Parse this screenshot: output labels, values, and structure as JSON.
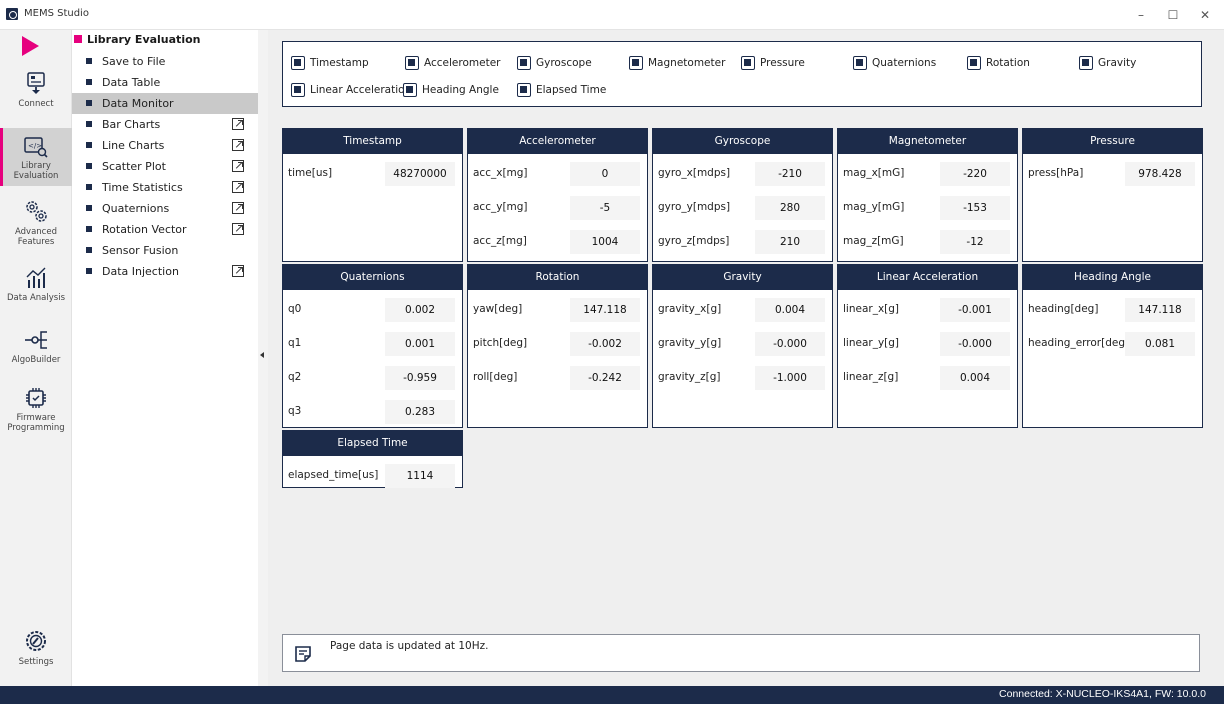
{
  "window": {
    "title": "MEMS Studio",
    "minimize": "–",
    "maximize": "☐",
    "close": "✕"
  },
  "rail": {
    "items": [
      {
        "label": "Connect",
        "icon": "connect-icon"
      },
      {
        "label": "Library Evaluation",
        "icon": "library-evaluation-icon"
      },
      {
        "label": "Advanced Features",
        "icon": "advanced-features-icon"
      },
      {
        "label": "Data Analysis",
        "icon": "data-analysis-icon"
      },
      {
        "label": "AlgoBuilder",
        "icon": "algobuilder-icon"
      },
      {
        "label": "Firmware Programming",
        "icon": "firmware-programming-icon"
      },
      {
        "label": "Settings",
        "icon": "settings-icon"
      }
    ],
    "active": "Library Evaluation"
  },
  "menu": {
    "header": "Library Evaluation",
    "items": [
      {
        "label": "Save to File",
        "external": false
      },
      {
        "label": "Data Table",
        "external": false
      },
      {
        "label": "Data Monitor",
        "external": false,
        "selected": true
      },
      {
        "label": "Bar Charts",
        "external": true
      },
      {
        "label": "Line Charts",
        "external": true
      },
      {
        "label": "Scatter Plot",
        "external": true
      },
      {
        "label": "Time Statistics",
        "external": true
      },
      {
        "label": "Quaternions",
        "external": true
      },
      {
        "label": "Rotation Vector",
        "external": true
      },
      {
        "label": "Sensor Fusion",
        "external": false
      },
      {
        "label": "Data Injection",
        "external": true
      }
    ]
  },
  "checkboxes": [
    {
      "label": "Timestamp",
      "checked": true
    },
    {
      "label": "Accelerometer",
      "checked": true
    },
    {
      "label": "Gyroscope",
      "checked": true
    },
    {
      "label": "Magnetometer",
      "checked": true
    },
    {
      "label": "Pressure",
      "checked": true
    },
    {
      "label": "Quaternions",
      "checked": true
    },
    {
      "label": "Rotation",
      "checked": true
    },
    {
      "label": "Gravity",
      "checked": true
    },
    {
      "label": "Linear Acceleration",
      "checked": true
    },
    {
      "label": "Heading Angle",
      "checked": true
    },
    {
      "label": "Elapsed Time",
      "checked": true
    }
  ],
  "cards": {
    "timestamp": {
      "title": "Timestamp",
      "rows": [
        {
          "label": "time[us]",
          "value": "48270000"
        }
      ]
    },
    "accelerometer": {
      "title": "Accelerometer",
      "rows": [
        {
          "label": "acc_x[mg]",
          "value": "0"
        },
        {
          "label": "acc_y[mg]",
          "value": "-5"
        },
        {
          "label": "acc_z[mg]",
          "value": "1004"
        }
      ]
    },
    "gyroscope": {
      "title": "Gyroscope",
      "rows": [
        {
          "label": "gyro_x[mdps]",
          "value": "-210"
        },
        {
          "label": "gyro_y[mdps]",
          "value": "280"
        },
        {
          "label": "gyro_z[mdps]",
          "value": "210"
        }
      ]
    },
    "magnetometer": {
      "title": "Magnetometer",
      "rows": [
        {
          "label": "mag_x[mG]",
          "value": "-220"
        },
        {
          "label": "mag_y[mG]",
          "value": "-153"
        },
        {
          "label": "mag_z[mG]",
          "value": "-12"
        }
      ]
    },
    "pressure": {
      "title": "Pressure",
      "rows": [
        {
          "label": "press[hPa]",
          "value": "978.428"
        }
      ]
    },
    "quaternions": {
      "title": "Quaternions",
      "rows": [
        {
          "label": "q0",
          "value": "0.002"
        },
        {
          "label": "q1",
          "value": "0.001"
        },
        {
          "label": "q2",
          "value": "-0.959"
        },
        {
          "label": "q3",
          "value": "0.283"
        }
      ]
    },
    "rotation": {
      "title": "Rotation",
      "rows": [
        {
          "label": "yaw[deg]",
          "value": "147.118"
        },
        {
          "label": "pitch[deg]",
          "value": "-0.002"
        },
        {
          "label": "roll[deg]",
          "value": "-0.242"
        }
      ]
    },
    "gravity": {
      "title": "Gravity",
      "rows": [
        {
          "label": "gravity_x[g]",
          "value": "0.004"
        },
        {
          "label": "gravity_y[g]",
          "value": "-0.000"
        },
        {
          "label": "gravity_z[g]",
          "value": "-1.000"
        }
      ]
    },
    "linear_acceleration": {
      "title": "Linear Acceleration",
      "rows": [
        {
          "label": "linear_x[g]",
          "value": "-0.001"
        },
        {
          "label": "linear_y[g]",
          "value": "-0.000"
        },
        {
          "label": "linear_z[g]",
          "value": "0.004"
        }
      ]
    },
    "heading_angle": {
      "title": "Heading Angle",
      "rows": [
        {
          "label": "heading[deg]",
          "value": "147.118"
        },
        {
          "label": "heading_error[deg]",
          "value": "0.081"
        }
      ]
    },
    "elapsed_time": {
      "title": "Elapsed Time",
      "rows": [
        {
          "label": "elapsed_time[us]",
          "value": "1114"
        }
      ]
    }
  },
  "footer": {
    "note": "Page data is updated at 10Hz.",
    "icon": "note-icon"
  },
  "status": {
    "text": "Connected:  X-NUCLEO-IKS4A1, FW: 10.0.0"
  },
  "colors": {
    "accent": "#e6007e",
    "navy": "#1c2b4a",
    "panel": "#efefef"
  }
}
